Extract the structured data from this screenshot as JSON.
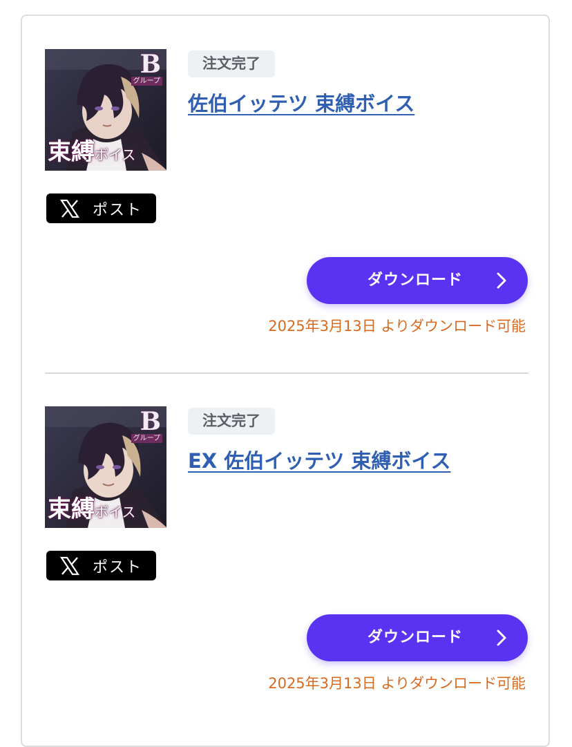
{
  "orders": [
    {
      "status": "注文完了",
      "title": "佐伯イッテツ 束縛ボイス",
      "thumbnail": {
        "grade": "B",
        "group": "グループ",
        "title_big": "束縛",
        "title_small": "ボイス"
      },
      "post_label": "ポスト",
      "download_label": "ダウンロード",
      "availability": "2025年3月13日 よりダウンロード可能"
    },
    {
      "status": "注文完了",
      "title": "EX 佐伯イッテツ 束縛ボイス",
      "thumbnail": {
        "grade": "B",
        "group": "グループ",
        "title_big": "束縛",
        "title_small": "ボイス"
      },
      "post_label": "ポスト",
      "download_label": "ダウンロード",
      "availability": "2025年3月13日 よりダウンロード可能"
    }
  ],
  "colors": {
    "download_button": "#5a33f2",
    "availability_text": "#d8691d",
    "link": "#2f5fb3",
    "badge_bg": "#eef1f4"
  },
  "icons": [
    "x-logo-icon",
    "chevron-right-icon"
  ]
}
